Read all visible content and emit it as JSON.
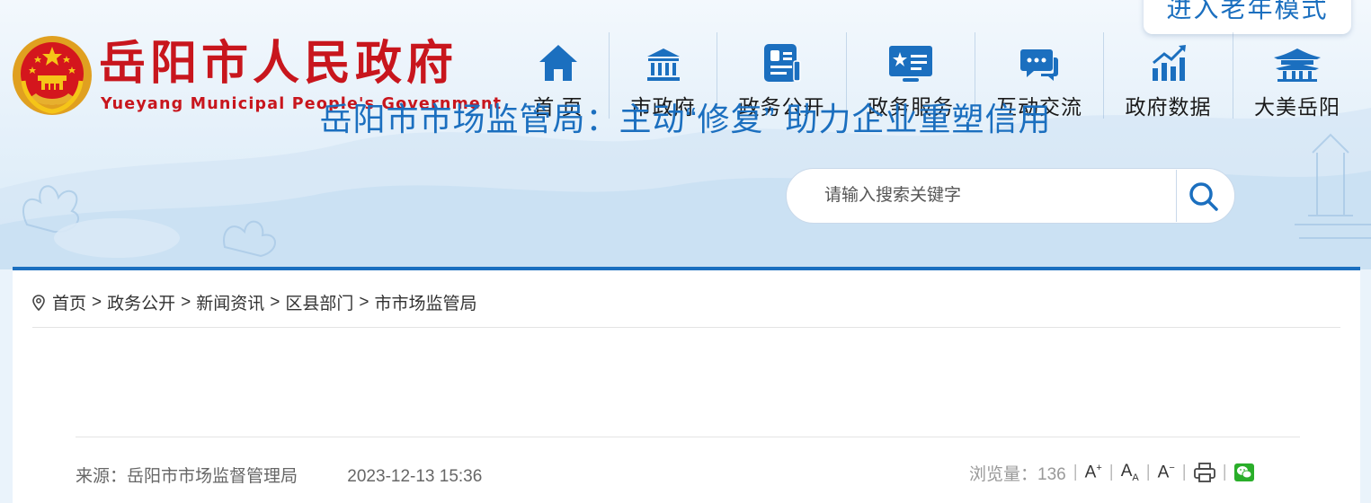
{
  "header": {
    "site_title": "岳阳市人民政府",
    "site_subtitle": "Yueyang Municipal People's Government",
    "elder_mode": "进入老年模式",
    "nav": [
      {
        "label": "首 页",
        "icon": "home-icon"
      },
      {
        "label": "市政府",
        "icon": "government-building-icon"
      },
      {
        "label": "政务公开",
        "icon": "document-icon"
      },
      {
        "label": "政务服务",
        "icon": "service-card-icon"
      },
      {
        "label": "互动交流",
        "icon": "chat-icon"
      },
      {
        "label": "政府数据",
        "icon": "data-chart-icon"
      },
      {
        "label": "大美岳阳",
        "icon": "pavilion-icon"
      }
    ],
    "search": {
      "placeholder": "请输入搜索关键字"
    }
  },
  "breadcrumb": {
    "items": [
      "首页",
      "政务公开",
      "新闻资讯",
      "区县部门",
      "市市场监管局"
    ],
    "separator": ">"
  },
  "article": {
    "title": "岳阳市市场监管局：主动“修复” 助力企业重塑信用",
    "source": "来源：岳阳市市场监督管理局",
    "date": "2023-12-13 15:36",
    "views": "浏览量：136"
  },
  "font_tools": {
    "larger": "A",
    "normal": "A",
    "smaller": "A"
  },
  "colors": {
    "brand_red": "#c8161d",
    "brand_blue": "#1b6fbf"
  }
}
